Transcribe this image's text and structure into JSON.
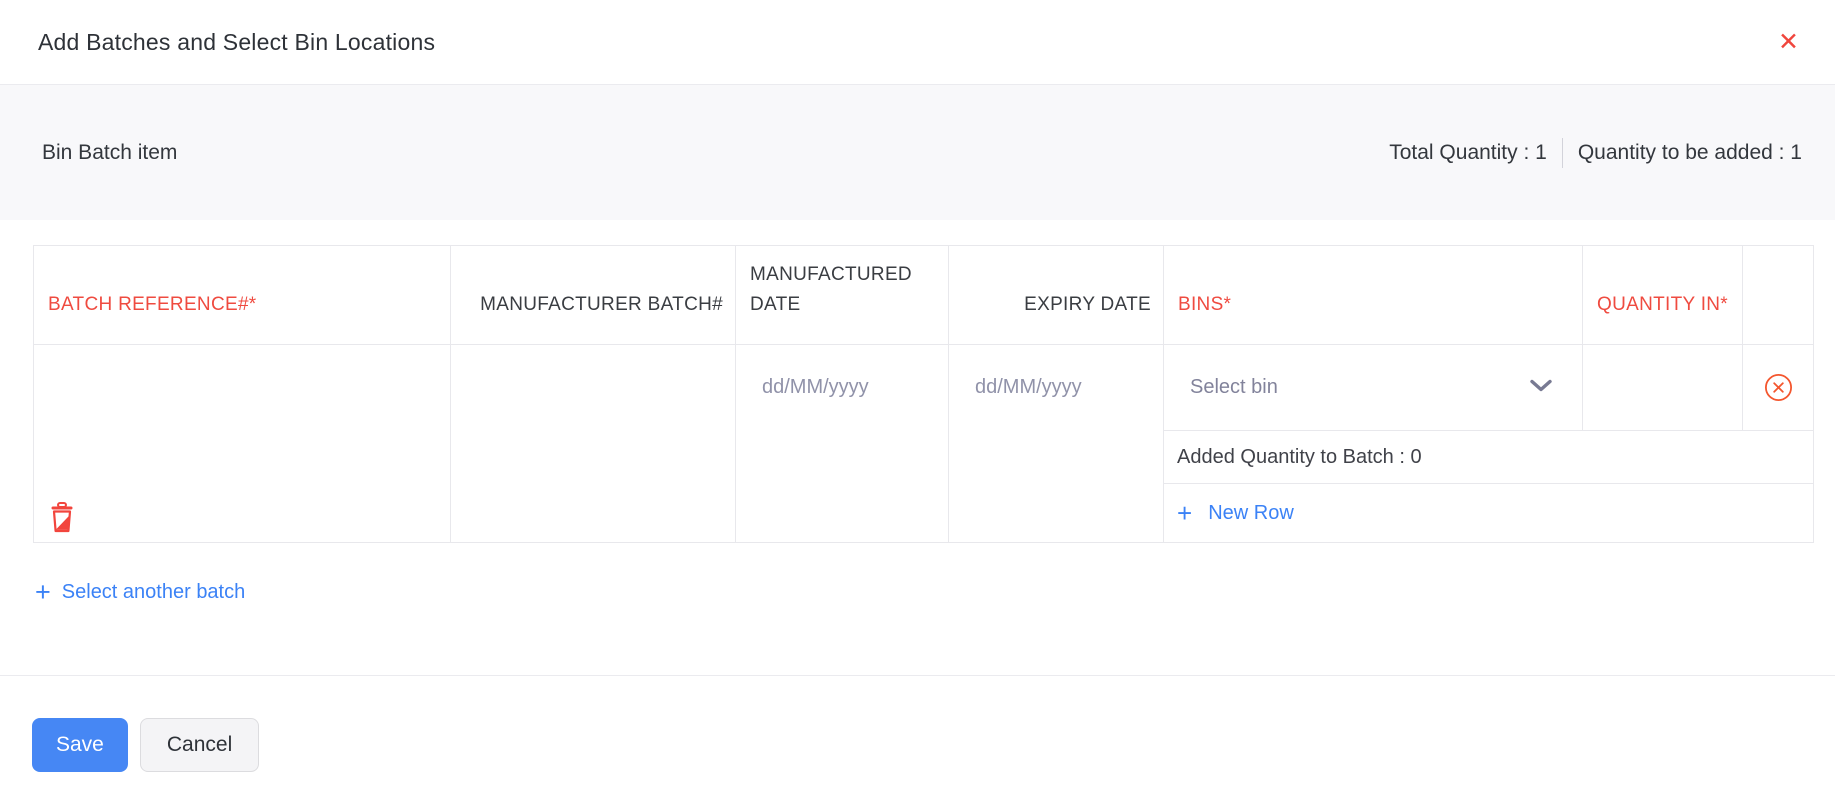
{
  "colors": {
    "required_red": "#ef4b40",
    "close_red": "#f0463d",
    "delete_icon_red": "#f4562e",
    "link_blue": "#3b82f6",
    "save_button_blue": "#4687f4",
    "dark_text": "#33373d",
    "placeholder_gray": "#9092a9",
    "strip_background": "#f8f8fa",
    "table_border": "#e8e8ec"
  },
  "header": {
    "title": "Add Batches and Select Bin Locations",
    "close_glyph": "✕"
  },
  "item_summary": {
    "item_name": "Bin Batch item",
    "total_quantity": "Total Quantity : 1",
    "quantity_to_be_added": "Quantity to be added : 1"
  },
  "table": {
    "columns": {
      "batch_reference": "BATCH REFERENCE#*",
      "manufacturer_batch": "MANUFACTURER BATCH#",
      "manufactured_date": "MANUFACTURED DATE",
      "expiry_date": "EXPIRY DATE",
      "bins": "BINS*",
      "quantity_in": "QUANTITY IN*"
    },
    "row": {
      "manufactured_date_placeholder": "dd/MM/yyyy",
      "expiry_date_placeholder": "dd/MM/yyyy",
      "bin_select_placeholder": "Select bin",
      "added_quantity_text": "Added Quantity to Batch : 0",
      "new_row_plus_glyph": "+",
      "new_row_label": "New Row"
    }
  },
  "actions": {
    "plus_glyph": "+",
    "select_another_batch_label": "Select another batch"
  },
  "footer": {
    "save_label": "Save",
    "cancel_label": "Cancel"
  }
}
